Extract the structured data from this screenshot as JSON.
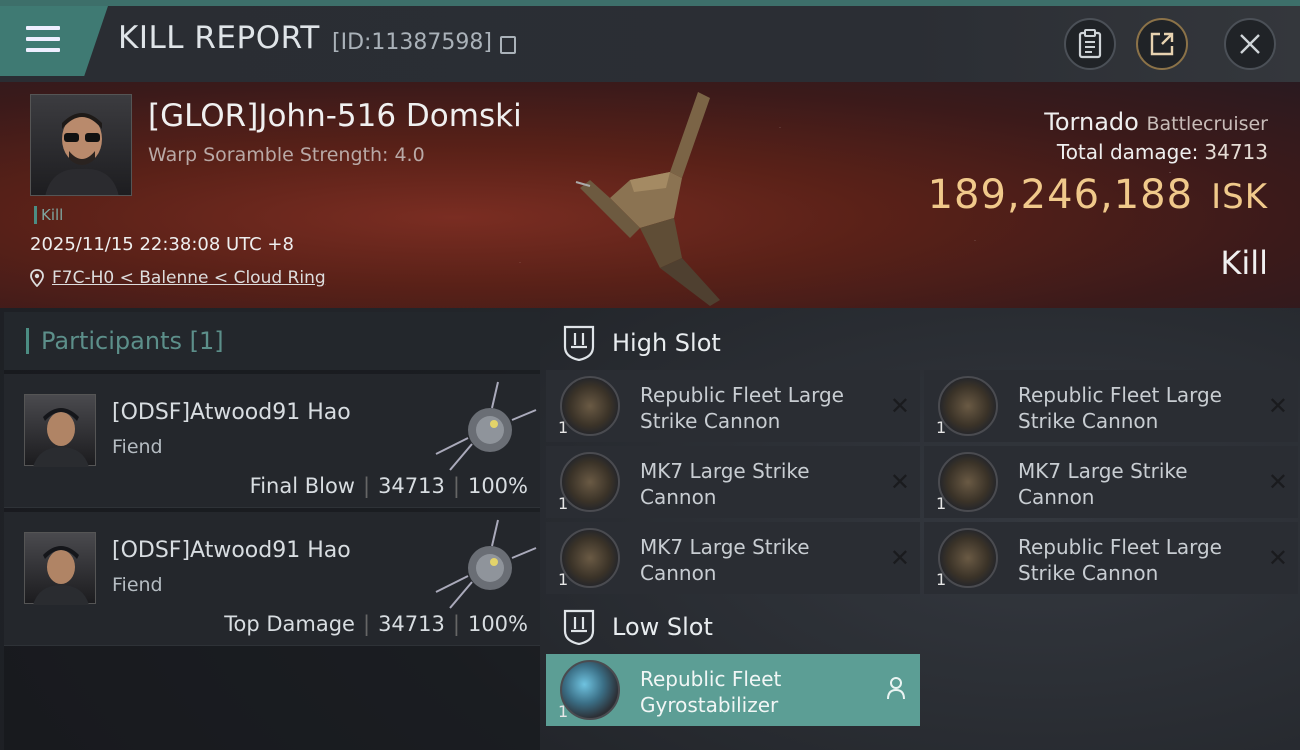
{
  "header": {
    "title": "KILL REPORT",
    "kill_id": "[ID:11387598]"
  },
  "victim": {
    "name": "[GLOR]John-516 Domski",
    "warp_scramble": "Warp Soramble Strength: 4.0",
    "kill_label": "Kill",
    "datetime": "2025/11/15 22:38:08 UTC +8",
    "location": "F7C-H0 < Balenne < Cloud Ring",
    "ship_name": "Tornado",
    "ship_class": "Battlecruiser",
    "total_damage_label": "Total damage:",
    "total_damage": "34713",
    "isk_value": "189,246,188",
    "isk_unit": "ISK",
    "result": "Kill"
  },
  "participants": {
    "title": "Participants",
    "count": "[1]",
    "rows": [
      {
        "name": "[ODSF]Atwood91 Hao",
        "ship": "Fiend",
        "role": "Final Blow",
        "damage": "34713",
        "percent": "100%"
      },
      {
        "name": "[ODSF]Atwood91 Hao",
        "ship": "Fiend",
        "role": "Top Damage",
        "damage": "34713",
        "percent": "100%"
      }
    ]
  },
  "high_slot": {
    "title": "High Slot",
    "modules": [
      {
        "name": "Republic Fleet Large Strike Cannon",
        "qty": "1"
      },
      {
        "name": "Republic Fleet Large Strike Cannon",
        "qty": "1"
      },
      {
        "name": "MK7 Large Strike Cannon",
        "qty": "1"
      },
      {
        "name": "MK7 Large Strike Cannon",
        "qty": "1"
      },
      {
        "name": "MK7 Large Strike Cannon",
        "qty": "1"
      },
      {
        "name": "Republic Fleet Large Strike Cannon",
        "qty": "1"
      }
    ]
  },
  "low_slot": {
    "title": "Low Slot",
    "modules": [
      {
        "name": "Republic Fleet Gyrostabilizer",
        "qty": "1"
      }
    ]
  },
  "colors": {
    "accent": "#3f7a73",
    "isk_gold": "#f0c98b",
    "highlight_module": "#5c9e95"
  }
}
